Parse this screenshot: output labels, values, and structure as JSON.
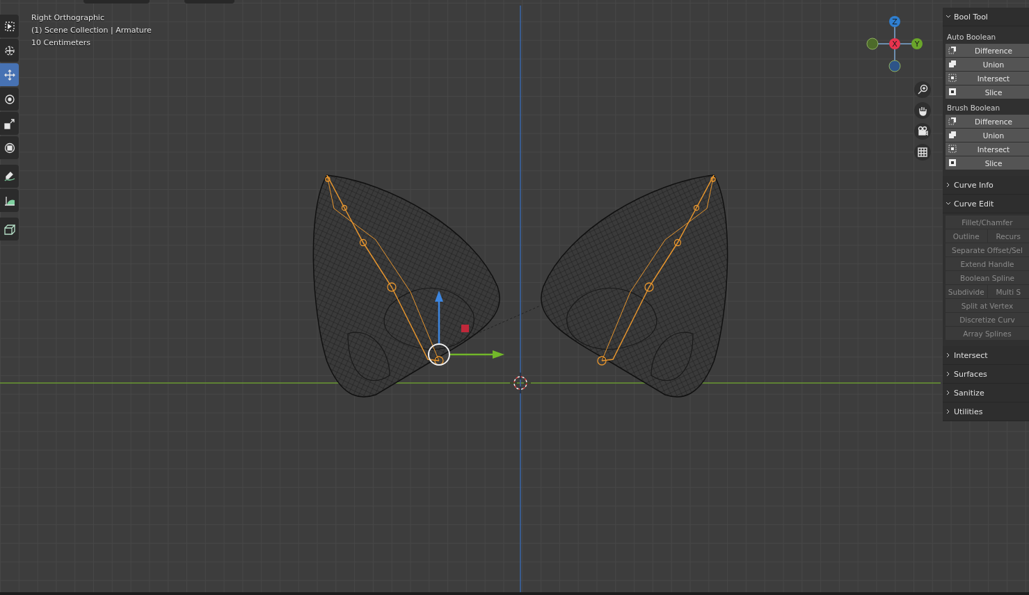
{
  "viewport": {
    "info_lines": [
      "Right Orthographic",
      "(1) Scene Collection | Armature",
      "10 Centimeters"
    ]
  },
  "toolbar": {
    "tools": [
      {
        "kind": "select",
        "selected": false
      },
      {
        "kind": "cursor",
        "selected": false
      },
      {
        "kind": "move",
        "selected": true
      },
      {
        "kind": "rotate",
        "selected": false
      },
      {
        "kind": "scale",
        "selected": false
      },
      {
        "kind": "transform",
        "selected": false
      },
      {
        "kind": "annotate",
        "selected": false
      },
      {
        "kind": "measure",
        "selected": false
      },
      {
        "kind": "add-cube",
        "selected": false
      }
    ]
  },
  "axis_gizmo": {
    "axes": [
      {
        "kind": "z",
        "label": "Z"
      },
      {
        "kind": "x",
        "label": "X"
      },
      {
        "kind": "y",
        "label": "Y"
      },
      {
        "kind": "neg-y"
      },
      {
        "kind": "neg-z"
      }
    ]
  },
  "nav_buttons": [
    {
      "kind": "zoom"
    },
    {
      "kind": "pan"
    },
    {
      "kind": "camera"
    },
    {
      "kind": "grid"
    }
  ],
  "sidebar": {
    "panels": [
      {
        "title": "Bool Tool",
        "expanded": true,
        "groups": [
          {
            "label": "Auto Boolean",
            "buttons": [
              {
                "kind": "difference",
                "label": "Difference"
              },
              {
                "kind": "union",
                "label": "Union"
              },
              {
                "kind": "intersect",
                "label": "Intersect"
              },
              {
                "kind": "slice",
                "label": "Slice"
              }
            ]
          },
          {
            "label": "Brush Boolean",
            "buttons": [
              {
                "kind": "difference",
                "label": "Difference"
              },
              {
                "kind": "union",
                "label": "Union"
              },
              {
                "kind": "intersect",
                "label": "Intersect"
              },
              {
                "kind": "slice",
                "label": "Slice"
              }
            ]
          }
        ]
      },
      {
        "title": "Curve Info",
        "expanded": false
      },
      {
        "title": "Curve Edit",
        "expanded": true,
        "rows": [
          {
            "buttons": [
              {
                "label": "Fillet/Chamfer",
                "disabled": true
              }
            ]
          },
          {
            "buttons": [
              {
                "label": "Outline",
                "disabled": true
              },
              {
                "label": "Recurs",
                "disabled": true
              }
            ]
          },
          {
            "buttons": [
              {
                "label": "Separate Offset/Sel",
                "disabled": true
              }
            ]
          },
          {
            "buttons": [
              {
                "label": "Extend Handle",
                "disabled": true
              }
            ]
          },
          {
            "buttons": [
              {
                "label": "Boolean Spline",
                "disabled": true
              }
            ]
          },
          {
            "buttons": [
              {
                "label": "Subdivide",
                "disabled": true
              },
              {
                "label": "Multi S",
                "disabled": true
              }
            ]
          },
          {
            "buttons": [
              {
                "label": "Split at Vertex",
                "disabled": true
              }
            ]
          },
          {
            "buttons": [
              {
                "label": "Discretize Curv",
                "disabled": true
              }
            ]
          },
          {
            "buttons": [
              {
                "label": "Array Splines",
                "disabled": true
              }
            ]
          }
        ]
      },
      {
        "title": "Intersect",
        "expanded": false
      },
      {
        "title": "Surfaces",
        "expanded": false
      },
      {
        "title": "Sanitize",
        "expanded": false
      },
      {
        "title": "Utilities",
        "expanded": false
      }
    ]
  }
}
